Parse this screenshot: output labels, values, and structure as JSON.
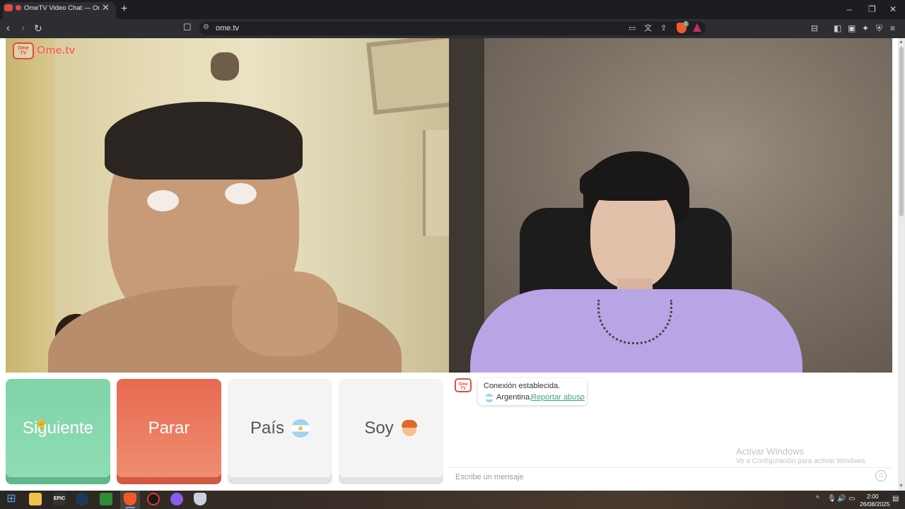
{
  "browser": {
    "tab_title": "OmeTV Video Chat — Omegle",
    "tab_close": "✕",
    "new_tab": "+",
    "url": "ome.tv",
    "window_controls": {
      "minimize": "–",
      "maximize": "❐",
      "close": "✕"
    },
    "shield_count": "2"
  },
  "page": {
    "logo": {
      "badge": "Ome TV",
      "text": "Ome.tv"
    },
    "buttons": {
      "next": "Siguiente",
      "stop": "Parar",
      "country": "País",
      "gender": "Soy"
    },
    "chat": {
      "avatar": "Ome TV",
      "message_status": "Conexión establecida.",
      "message_country": "Argentina.",
      "report_link": "Reportar abuso",
      "report_suffix": ".",
      "input_placeholder": "Escribe un mensaje"
    },
    "watermark": {
      "title": "Activar Windows",
      "subtitle": "Ve a Configuración para activar Windows."
    }
  },
  "taskbar": {
    "apps": [
      "windows-start",
      "file-explorer",
      "epic-games",
      "steam",
      "xbox",
      "brave",
      "opera-gx",
      "discord-like",
      "shield-app"
    ],
    "epic_label": "EPIC",
    "time": "2:00",
    "date": "26/08/2025"
  },
  "colors": {
    "next_button": "#7fd4a8",
    "stop_button": "#e86a52",
    "neutral_button": "#f4f4f4",
    "brand": "#e24b44",
    "report_link": "#3aa779"
  }
}
